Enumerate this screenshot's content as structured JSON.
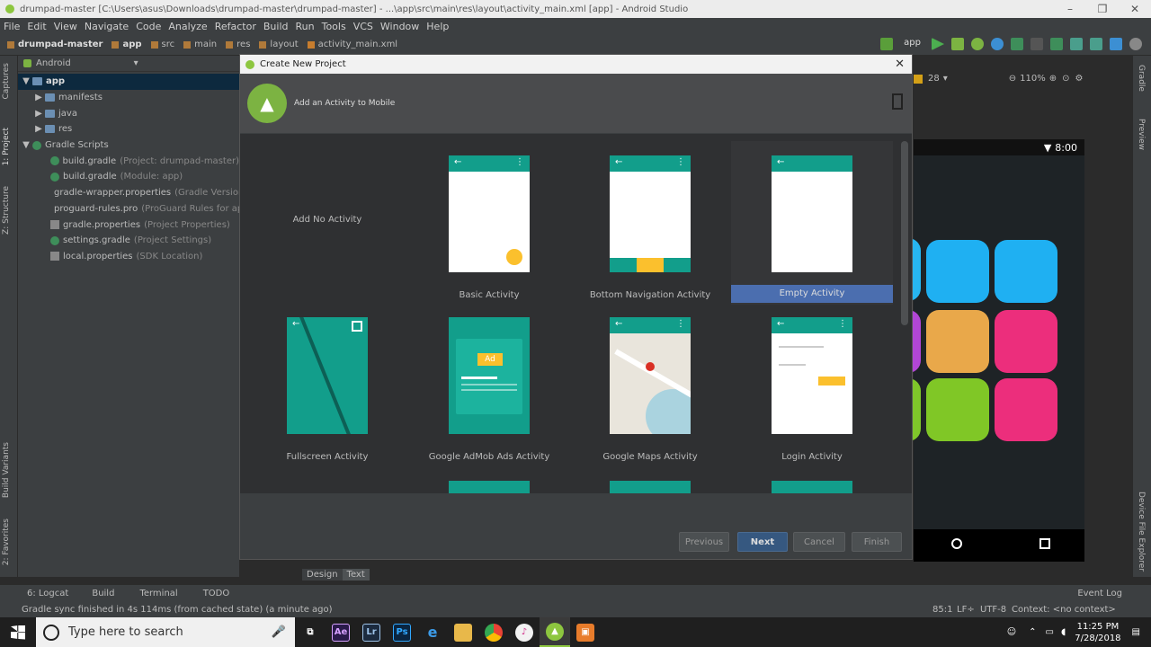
{
  "window": {
    "title": "drumpad-master [C:\\Users\\asus\\Downloads\\drumpad-master\\drumpad-master] - ...\\app\\src\\main\\res\\layout\\activity_main.xml [app] - Android Studio",
    "controls": [
      "–",
      "❐",
      "✕"
    ]
  },
  "menu": [
    "File",
    "Edit",
    "View",
    "Navigate",
    "Code",
    "Analyze",
    "Refactor",
    "Build",
    "Run",
    "Tools",
    "VCS",
    "Window",
    "Help"
  ],
  "breadcrumbs": [
    "drumpad-master",
    "app",
    "src",
    "main",
    "res",
    "layout",
    "activity_main.xml"
  ],
  "run_config": "app",
  "left_tabs": {
    "captures": "Captures",
    "project": "1: Project",
    "structure": "Z: Structure",
    "build_variants": "Build Variants",
    "favorites": "2: Favorites"
  },
  "project_view": "Android",
  "tree": [
    {
      "label": "app",
      "type": "folder",
      "indent": 0,
      "selected": true,
      "expand": "▼"
    },
    {
      "label": "manifests",
      "type": "folder",
      "indent": 1,
      "expand": "▶"
    },
    {
      "label": "java",
      "type": "folder",
      "indent": 1,
      "expand": "▶"
    },
    {
      "label": "res",
      "type": "folder",
      "indent": 1,
      "expand": "▶"
    },
    {
      "label": "Gradle Scripts",
      "type": "grad",
      "indent": 0,
      "expand": "▼"
    },
    {
      "label": "build.gradle",
      "hint": "(Project: drumpad-master)",
      "type": "grad",
      "indent": 2
    },
    {
      "label": "build.gradle",
      "hint": "(Module: app)",
      "type": "grad",
      "indent": 2
    },
    {
      "label": "gradle-wrapper.properties",
      "hint": "(Gradle Version)",
      "type": "prop",
      "indent": 2
    },
    {
      "label": "proguard-rules.pro",
      "hint": "(ProGuard Rules for app)",
      "type": "prop",
      "indent": 2
    },
    {
      "label": "gradle.properties",
      "hint": "(Project Properties)",
      "type": "prop",
      "indent": 2
    },
    {
      "label": "settings.gradle",
      "hint": "(Project Settings)",
      "type": "grad",
      "indent": 2
    },
    {
      "label": "local.properties",
      "hint": "(SDK Location)",
      "type": "prop",
      "indent": 2
    }
  ],
  "editor": {
    "api": "28",
    "zoom": "110%",
    "phone_time": "8:00",
    "design_tab": "Design",
    "text_tab": "Text"
  },
  "right_tabs": {
    "gradle": "Gradle",
    "preview": "Preview",
    "device_explorer": "Device File Explorer"
  },
  "dialog": {
    "title": "Create New Project",
    "subtitle": "Add an Activity to Mobile",
    "close": "✕",
    "activities": [
      {
        "label": "Add No Activity"
      },
      {
        "label": "Basic Activity"
      },
      {
        "label": "Bottom Navigation Activity"
      },
      {
        "label": "Empty Activity",
        "selected": true
      },
      {
        "label": "Fullscreen Activity"
      },
      {
        "label": "Google AdMob Ads Activity",
        "badge": "Ad"
      },
      {
        "label": "Google Maps Activity"
      },
      {
        "label": "Login Activity"
      }
    ],
    "buttons": {
      "previous": "Previous",
      "next": "Next",
      "cancel": "Cancel",
      "finish": "Finish"
    }
  },
  "bottom_tabs": [
    "6: Logcat",
    "Build",
    "Terminal",
    "TODO"
  ],
  "event_log": "Event Log",
  "status": {
    "message": "Gradle sync finished in 4s 114ms (from cached state) (a minute ago)",
    "position": "85:1",
    "line_sep": "LF÷",
    "encoding": "UTF-8",
    "context": "Context: <no context>"
  },
  "taskbar": {
    "search_placeholder": "Type here to search",
    "apps": [
      {
        "name": "Ae",
        "color": "#2a1a4a",
        "fg": "#d6a0ff"
      },
      {
        "name": "Lr",
        "color": "#1c2b3f",
        "fg": "#9ec4ea"
      },
      {
        "name": "Ps",
        "color": "#0a2540",
        "fg": "#31a8ff"
      },
      {
        "name": "e",
        "color": "#1f1f1f",
        "fg": "#3c9be8"
      },
      {
        "name": "▬",
        "color": "#e8b84a",
        "fg": "#7a5a1a"
      },
      {
        "name": "●",
        "color": "#1f1f1f",
        "fg": "#e34c2b"
      },
      {
        "name": "♪",
        "color": "#f2f2f2",
        "fg": "#d0308a"
      },
      {
        "name": "A",
        "color": "#3a3a3a",
        "fg": "#8dc63f"
      },
      {
        "name": "▣",
        "color": "#e87c2b",
        "fg": "#fff"
      }
    ],
    "time": "11:25 PM",
    "date": "7/28/2018"
  },
  "colors": {
    "accent": "#129e8b",
    "selection": "#4b6eaf",
    "fab": "#fbc02d"
  }
}
